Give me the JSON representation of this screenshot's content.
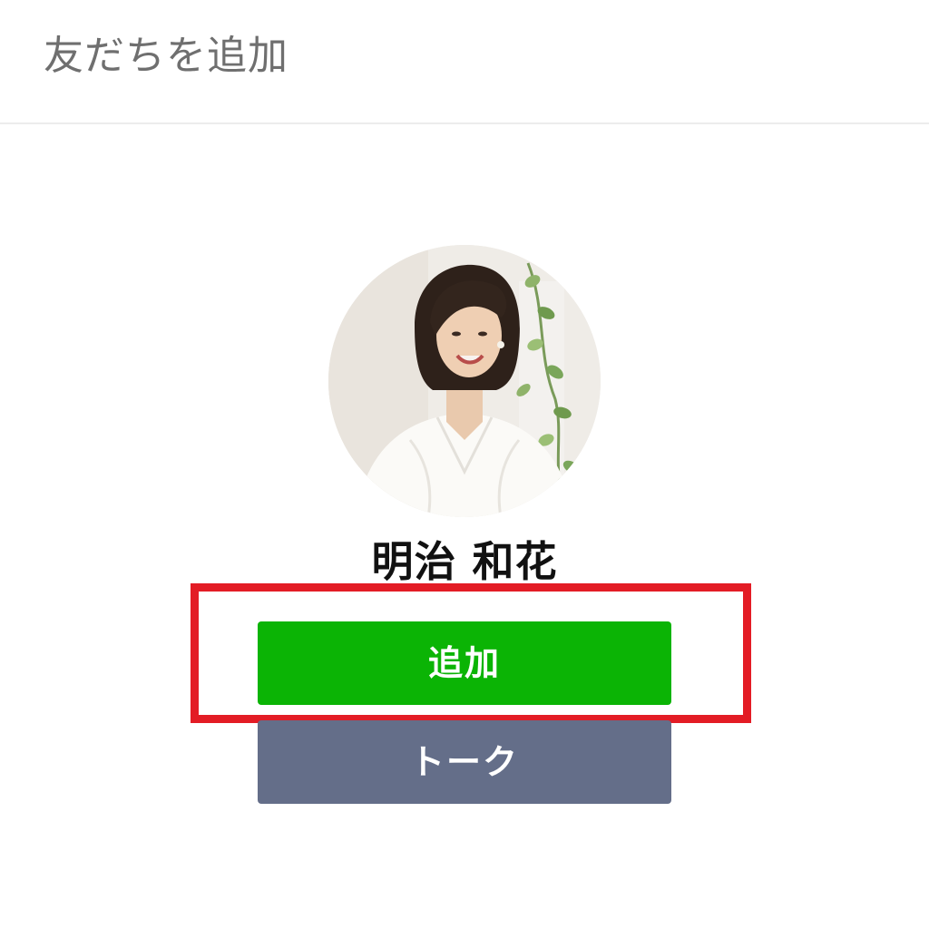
{
  "header": {
    "title": "友だちを追加"
  },
  "profile": {
    "avatar_icon": "profile-photo",
    "name": "明治 和花"
  },
  "actions": {
    "add_label": "追加",
    "talk_label": "トーク"
  },
  "colors": {
    "add_button": "#0bb405",
    "talk_button": "#646e89",
    "highlight": "#e31c25",
    "header_text": "#6f6f6f"
  }
}
